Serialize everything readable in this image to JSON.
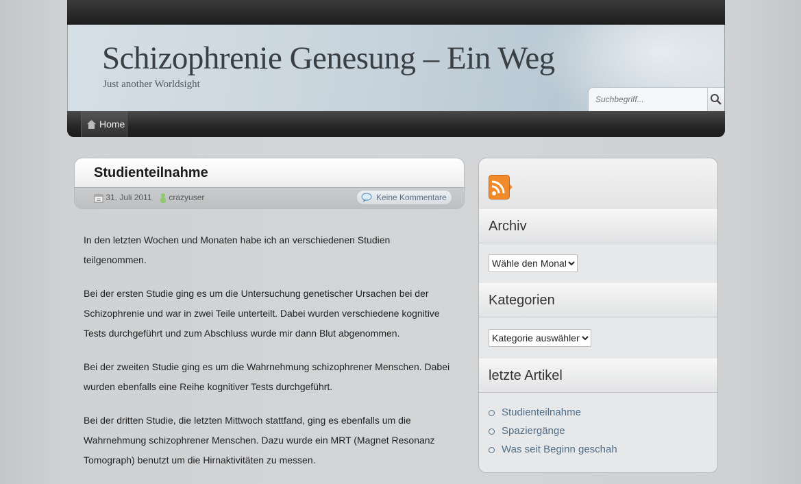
{
  "header": {
    "title": "Schizophrenie Genesung – Ein Weg",
    "tagline": "Just another Worldsight",
    "search_placeholder": "Suchbegriff..."
  },
  "nav": {
    "home_label": "Home"
  },
  "post": {
    "title": "Studienteilnahme",
    "date": "31. Juli 2011",
    "author": "crazyuser",
    "comments_label": "Keine Kommentare",
    "paragraphs": [
      "In den letzten Wochen und Monaten habe ich an verschiedenen Studien teilgenommen.",
      "Bei der ersten Studie ging es um die Untersuchung genetischer Ursachen bei der Schizophrenie und war in zwei Teile unterteilt. Dabei wurden verschiedene kognitive Tests durchgeführt und zum Abschluss wurde mir dann Blut abgenommen.",
      "Bei der zweiten Studie ging es um die Wahrnehmung schizophrener Menschen. Dabei wurden ebenfalls eine Reihe kognitiver Tests durchgeführt.",
      "Bei der dritten Studie, die letzten Mittwoch stattfand, ging es ebenfalls um die Wahrnehmung schizophrener Menschen. Dazu wurde ein MRT (Magnet Resonanz Tomograph) benutzt um die Hirnaktivitäten zu messen."
    ]
  },
  "sidebar": {
    "archive_title": "Archiv",
    "archive_select": "Wähle den Monat",
    "categories_title": "Kategorien",
    "categories_select": "Kategorie auswählen",
    "recent_title": "letzte Artikel",
    "recent_items": [
      "Studienteilnahme",
      "Spaziergänge",
      "Was seit Beginn geschah"
    ]
  },
  "colors": {
    "link": "#4f6d88",
    "rss": "#f07a1a",
    "nav_bg": "#262626"
  }
}
